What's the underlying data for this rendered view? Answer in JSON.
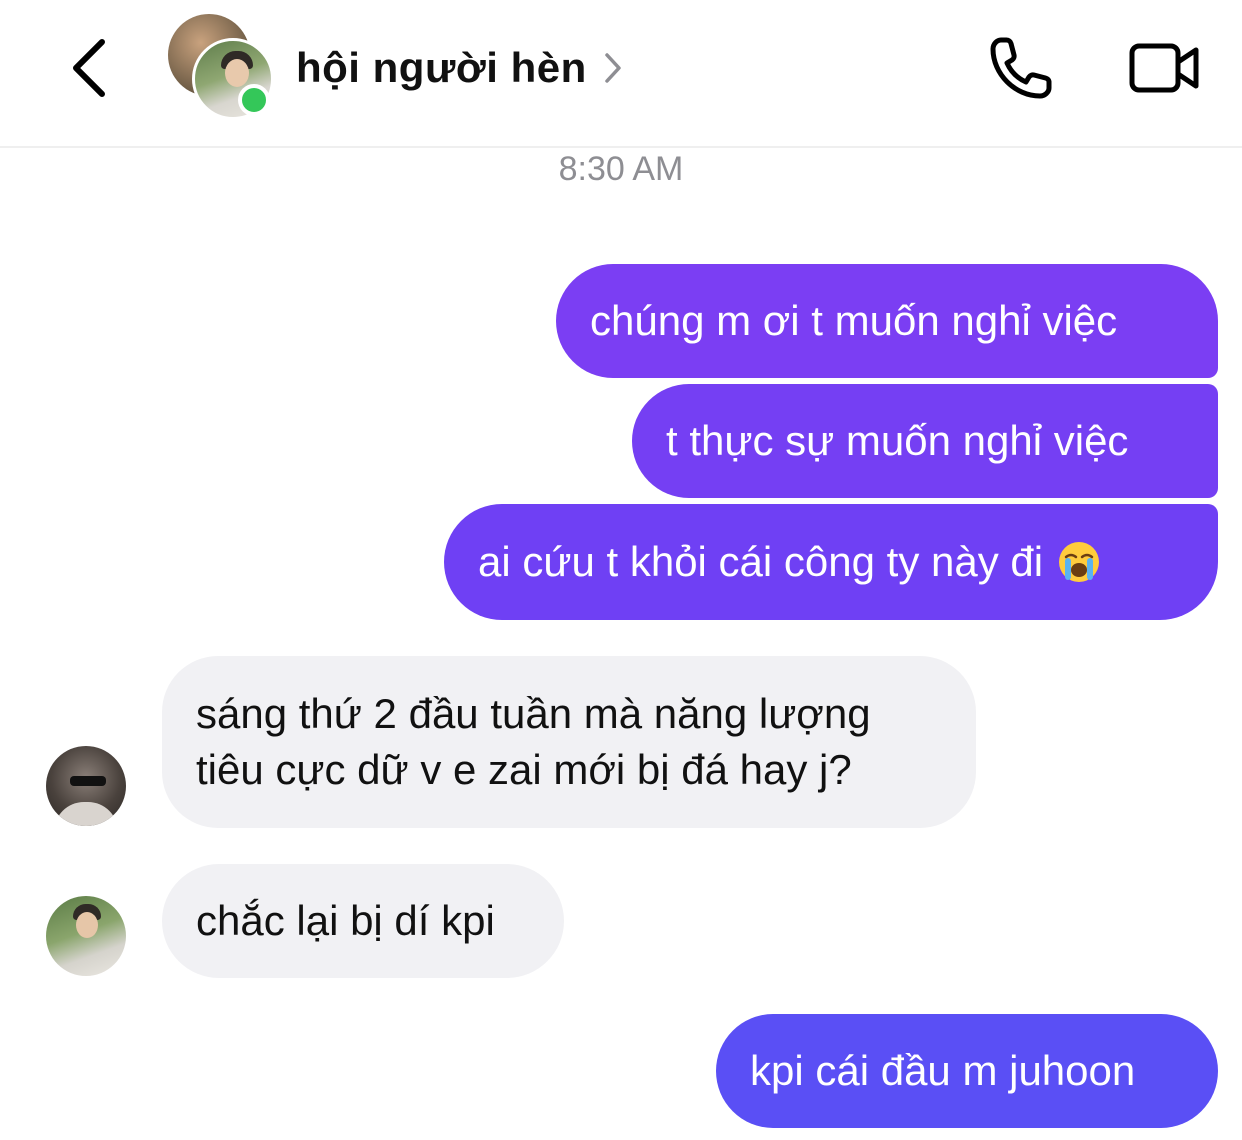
{
  "header": {
    "title": "hội người hèn",
    "icons": {
      "back": "chevron-left-icon",
      "details": "chevron-right-icon",
      "call": "phone-icon",
      "video": "video-camera-icon"
    },
    "online_color": "#34c759"
  },
  "timestamp": "8:30 AM",
  "colors": {
    "outgoing_top": "#7b3ff2",
    "outgoing_bottom": "#5a4ff5",
    "incoming_bg": "#f1f1f4",
    "timestamp": "#8e8e93"
  },
  "messages": [
    {
      "direction": "outgoing",
      "text": "chúng m ơi t muốn nghỉ việc"
    },
    {
      "direction": "outgoing",
      "text": "t thực sự muốn nghỉ việc"
    },
    {
      "direction": "outgoing",
      "text": "ai cứu t khỏi cái công ty này đi",
      "emoji": "loudly-crying-face-emoji"
    },
    {
      "direction": "incoming",
      "text": "sáng thứ 2 đầu tuần mà năng lượng\ntiêu cực dữ v e zai mới bị đá hay j?"
    },
    {
      "direction": "incoming",
      "text": "chắc lại bị dí kpi"
    },
    {
      "direction": "outgoing",
      "text": "kpi cái đầu m juhoon"
    }
  ]
}
